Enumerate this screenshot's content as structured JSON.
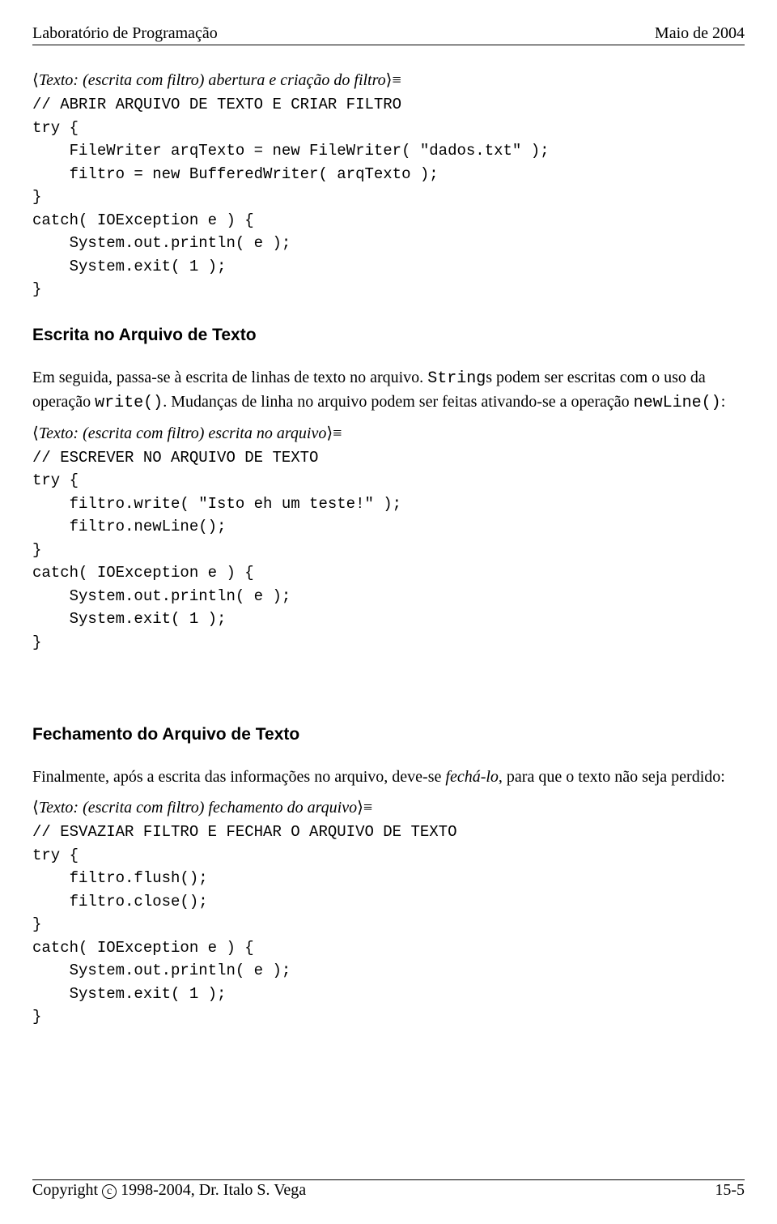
{
  "header": {
    "left": "Laboratório de Programação",
    "right": "Maio de 2004"
  },
  "section1": {
    "label": "Texto: (escrita com filtro) abertura e criação do filtro",
    "code": "// ABRIR ARQUIVO DE TEXTO E CRIAR FILTRO\ntry {\n    FileWriter arqTexto = new FileWriter( \"dados.txt\" );\n    filtro = new BufferedWriter( arqTexto );\n}\ncatch( IOException e ) {\n    System.out.println( e );\n    System.exit( 1 );\n}"
  },
  "heading2": "Escrita no Arquivo de Texto",
  "para2a": "Em seguida, passa-se à escrita de linhas de texto no arquivo. ",
  "para2b_mono": "String",
  "para2c": "s podem ser escritas com o uso da operação ",
  "para2d_mono": "write()",
  "para2e": ". Mudanças de linha no arquivo podem ser feitas ativando-se a operação ",
  "para2f_mono": "newLine()",
  "para2g": ":",
  "section2": {
    "label": "Texto: (escrita com filtro) escrita no arquivo",
    "code": "// ESCREVER NO ARQUIVO DE TEXTO\ntry {\n    filtro.write( \"Isto eh um teste!\" );\n    filtro.newLine();\n}\ncatch( IOException e ) {\n    System.out.println( e );\n    System.exit( 1 );\n}"
  },
  "heading3": "Fechamento do Arquivo de Texto",
  "para3a": "Finalmente, após a escrita das informações no arquivo, deve-se ",
  "para3b_italic": "fechá-lo",
  "para3c": ", para que o texto não seja perdido:",
  "section3": {
    "label": "Texto: (escrita com filtro) fechamento do arquivo",
    "code": "// ESVAZIAR FILTRO E FECHAR O ARQUIVO DE TEXTO\ntry {\n    filtro.flush();\n    filtro.close();\n}\ncatch( IOException e ) {\n    System.out.println( e );\n    System.exit( 1 );\n}"
  },
  "footer": {
    "copy_prefix": "Copyright ",
    "copy_c": "c",
    "copy_suffix": "1998-2004, Dr. Italo S. Vega",
    "page": "15-5"
  }
}
